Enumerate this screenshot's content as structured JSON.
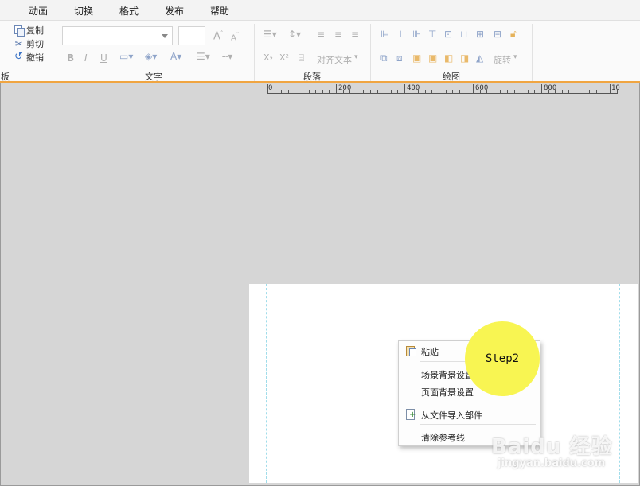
{
  "menu": {
    "items": [
      {
        "label": "动画"
      },
      {
        "label": "切换"
      },
      {
        "label": "格式"
      },
      {
        "label": "发布"
      },
      {
        "label": "帮助"
      }
    ]
  },
  "ribbon": {
    "clipboard": {
      "copy": "复制",
      "cut": "剪切",
      "undo": "撤销",
      "group_partial": "板"
    },
    "text_group_label": "文字",
    "paragraph_group_label": "段落",
    "paragraph_align_text": "对齐文本",
    "drawing_group_label": "绘图",
    "drawing_rotate": "旋转",
    "accent_color": "#f0a541"
  },
  "ruler": {
    "labels": [
      "0",
      "200",
      "400",
      "600",
      "800",
      "10"
    ]
  },
  "context_menu": {
    "items": [
      {
        "label": "粘贴",
        "icon": "paste-icon"
      },
      {
        "label": "场景背景设置",
        "icon": ""
      },
      {
        "label": "页面背景设置",
        "icon": ""
      },
      {
        "label": "从文件导入部件",
        "icon": "import-icon"
      },
      {
        "label": "清除参考线",
        "icon": ""
      }
    ]
  },
  "annotation": {
    "step_label": "Step2",
    "color": "#f8f552"
  },
  "watermark": {
    "brand": "Baidu 经验",
    "url": "jingyan.baidu.com"
  }
}
